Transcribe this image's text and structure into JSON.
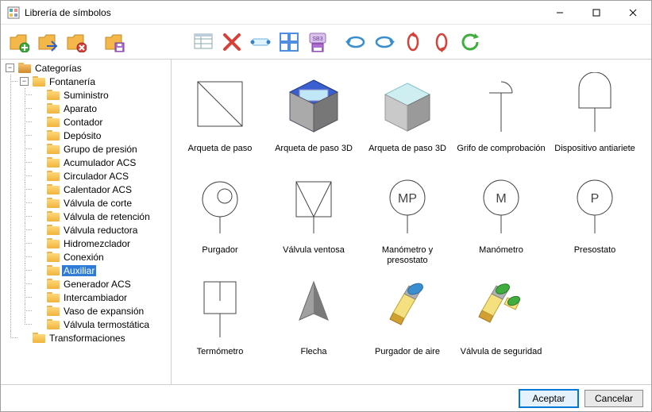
{
  "window": {
    "title": "Librería de símbolos"
  },
  "toolbar": {
    "icons": [
      "folder-add",
      "folder-open",
      "folder-delete",
      "folder-save",
      "table-browse",
      "delete-x",
      "caption",
      "tile-2x2",
      "sb3",
      "rotate-ccw-x",
      "rotate-cw-x",
      "rotate-ccw-y",
      "rotate-cw-y",
      "refresh"
    ]
  },
  "sidebar": {
    "root_label": "Categorías",
    "groups": [
      {
        "label": "Fontanería",
        "expanded": true,
        "children": [
          {
            "label": "Suministro"
          },
          {
            "label": "Aparato"
          },
          {
            "label": "Contador"
          },
          {
            "label": "Depósito"
          },
          {
            "label": "Grupo de presión"
          },
          {
            "label": "Acumulador ACS"
          },
          {
            "label": "Circulador ACS"
          },
          {
            "label": "Calentador ACS"
          },
          {
            "label": "Válvula de corte"
          },
          {
            "label": "Válvula de retención"
          },
          {
            "label": "Válvula reductora"
          },
          {
            "label": "Hidromezclador"
          },
          {
            "label": "Conexión"
          },
          {
            "label": "Auxiliar",
            "selected": true
          },
          {
            "label": "Generador ACS"
          },
          {
            "label": "Intercambiador"
          },
          {
            "label": "Vaso de expansión"
          },
          {
            "label": "Válvula termostática"
          }
        ]
      },
      {
        "label": "Transformaciones",
        "expanded": false,
        "children": []
      }
    ]
  },
  "symbols": [
    {
      "label": "Arqueta de paso",
      "icon": "square-diag"
    },
    {
      "label": "Arqueta de paso 3D",
      "icon": "box3d-blue"
    },
    {
      "label": "Arqueta de paso 3D",
      "icon": "box3d-gray"
    },
    {
      "label": "Grifo de comprobación",
      "icon": "faucet"
    },
    {
      "label": "Dispositivo antiariete",
      "icon": "antihammer"
    },
    {
      "label": "Purgador",
      "icon": "purgador"
    },
    {
      "label": "Válvula ventosa",
      "icon": "ventosa"
    },
    {
      "label": "Manómetro y presostato",
      "icon": "gauge-mp"
    },
    {
      "label": "Manómetro",
      "icon": "gauge-m"
    },
    {
      "label": "Presostato",
      "icon": "gauge-p"
    },
    {
      "label": "Termómetro",
      "icon": "thermometer"
    },
    {
      "label": "Flecha",
      "icon": "arrow3d"
    },
    {
      "label": "Purgador de aire",
      "icon": "bolt-blue"
    },
    {
      "label": "Válvula de seguridad",
      "icon": "bolt-green"
    }
  ],
  "footer": {
    "ok": "Aceptar",
    "cancel": "Cancelar"
  }
}
